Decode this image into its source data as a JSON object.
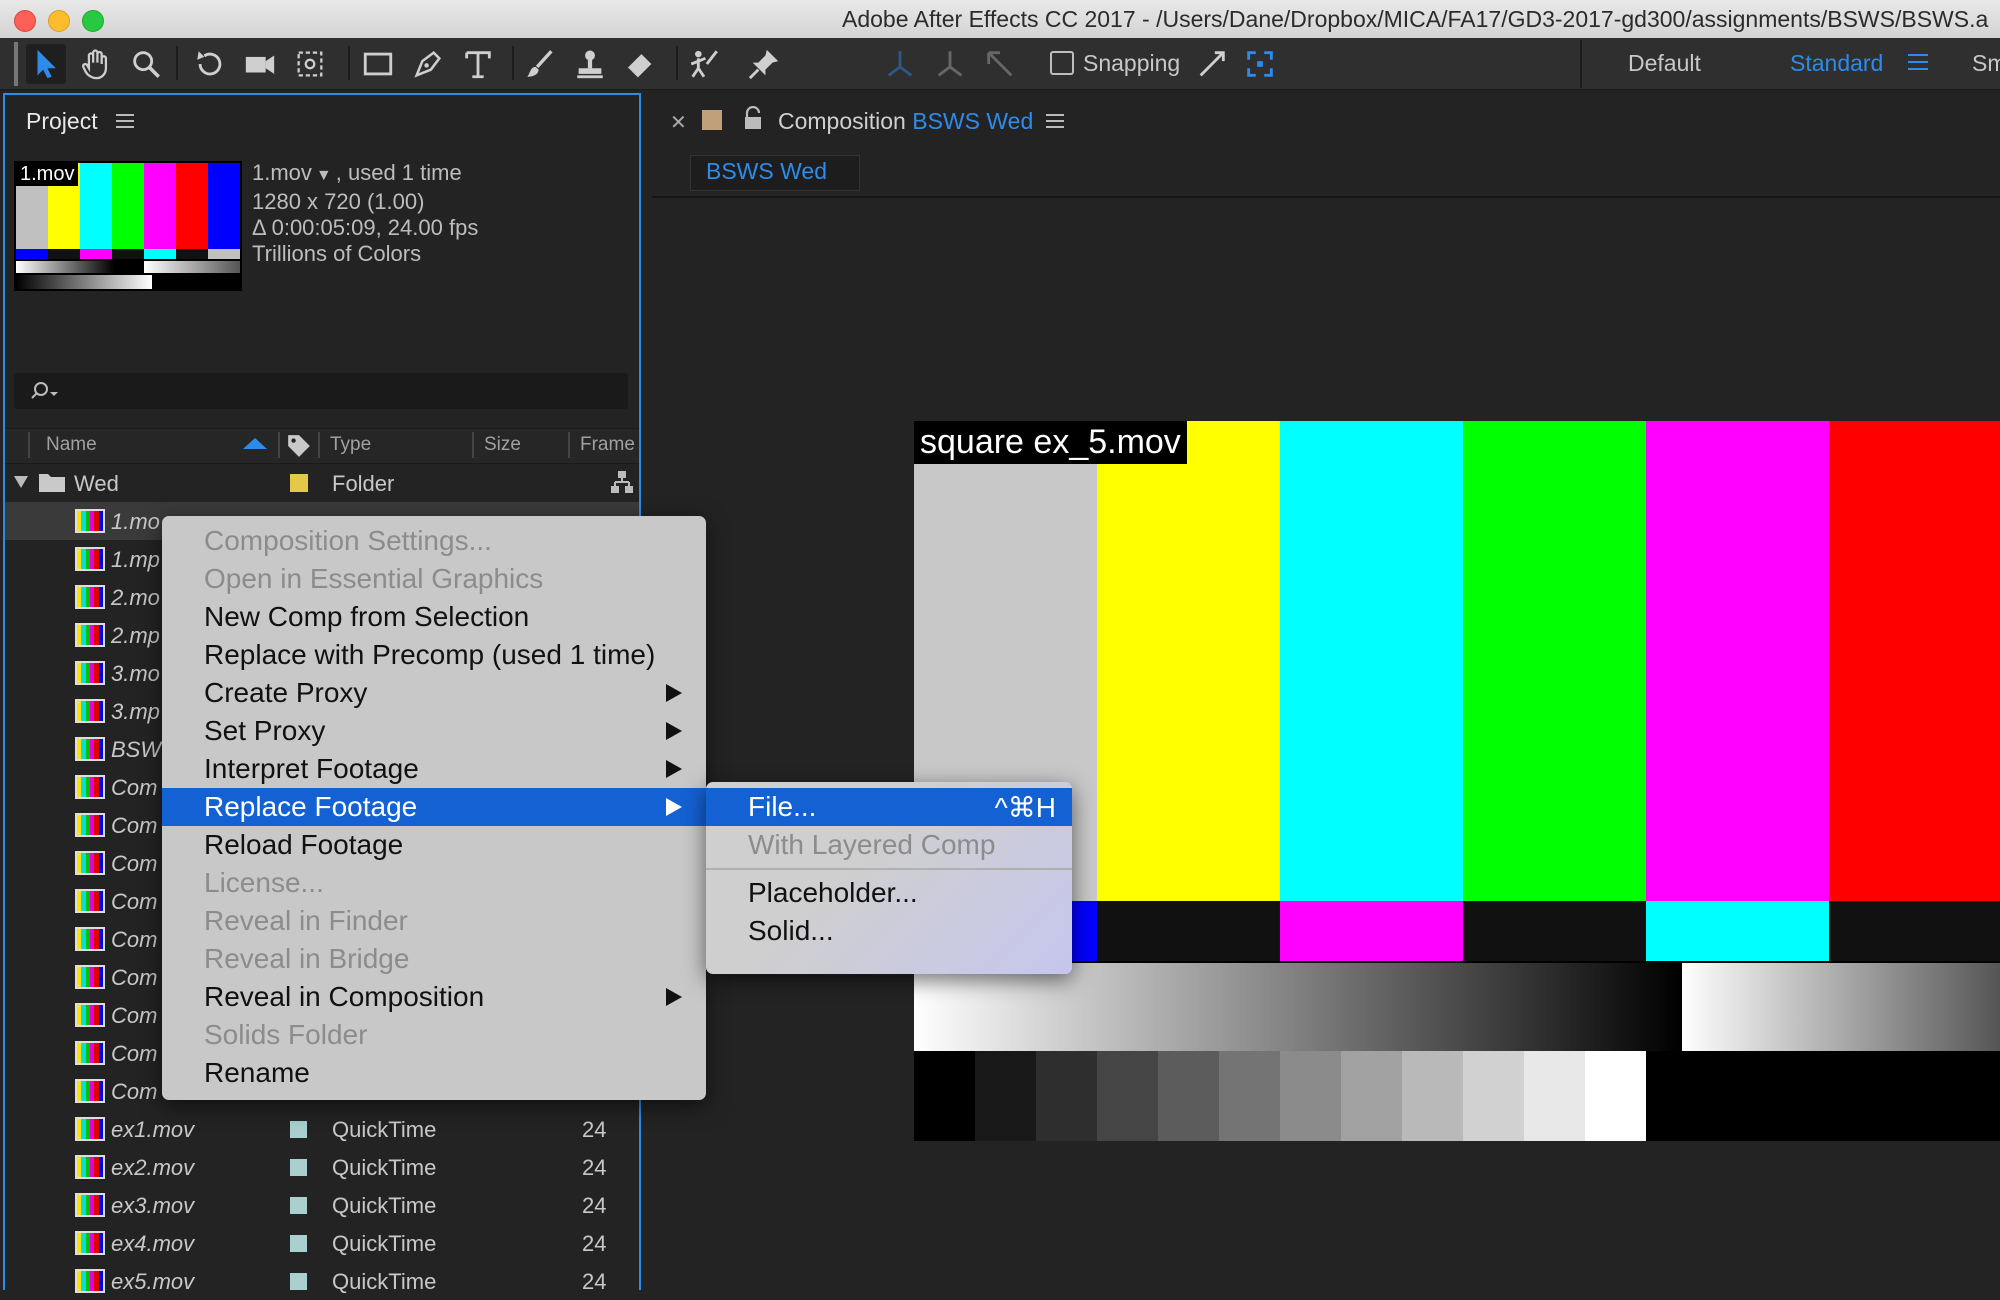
{
  "window": {
    "title": "Adobe After Effects CC 2017 - /Users/Dane/Dropbox/MICA/FA17/GD3-2017-gd300/assignments/BSWS/BSWS.a"
  },
  "toolbar": {
    "snapping_label": "Snapping",
    "workspace_default": "Default",
    "workspace_standard": "Standard",
    "workspace_small": "Sm",
    "accent": "#2d8ceb"
  },
  "project": {
    "title": "Project",
    "thumb_label": "1.mov",
    "info": {
      "name": "1.mov",
      "used": ", used 1 time",
      "dimensions": "1280 x 720 (1.00)",
      "duration": "Δ 0:00:05:09, 24.00 fps",
      "colors": "Trillions of Colors"
    },
    "search_icon": "search-icon",
    "columns": {
      "name": "Name",
      "type": "Type",
      "size": "Size",
      "frame": "Frame"
    },
    "folder": {
      "name": "Wed",
      "type": "Folder",
      "label_color": "#e4c84a"
    },
    "items": [
      {
        "name": "1.mo",
        "type": "",
        "frame": ""
      },
      {
        "name": "1.mp",
        "type": "",
        "frame": ""
      },
      {
        "name": "2.mo",
        "type": "",
        "frame": ""
      },
      {
        "name": "2.mp",
        "type": "",
        "frame": ""
      },
      {
        "name": "3.mo",
        "type": "",
        "frame": ""
      },
      {
        "name": "3.mp",
        "type": "",
        "frame": ""
      },
      {
        "name": "BSWS",
        "type": "",
        "frame": ""
      },
      {
        "name": "Com",
        "type": "",
        "frame": ""
      },
      {
        "name": "Com",
        "type": "",
        "frame": ""
      },
      {
        "name": "Com",
        "type": "",
        "frame": ""
      },
      {
        "name": "Com",
        "type": "",
        "frame": ""
      },
      {
        "name": "Com",
        "type": "",
        "frame": ""
      },
      {
        "name": "Com",
        "type": "",
        "frame": ""
      },
      {
        "name": "Com",
        "type": "",
        "frame": ""
      },
      {
        "name": "Com",
        "type": "",
        "frame": ""
      },
      {
        "name": "Com",
        "type": "",
        "frame": ""
      },
      {
        "name": "ex1.mov",
        "type": "QuickTime",
        "frame": "24"
      },
      {
        "name": "ex2.mov",
        "type": "QuickTime",
        "frame": "24"
      },
      {
        "name": "ex3.mov",
        "type": "QuickTime",
        "frame": "24"
      },
      {
        "name": "ex4.mov",
        "type": "QuickTime",
        "frame": "24"
      },
      {
        "name": "ex5.mov",
        "type": "QuickTime",
        "frame": "24"
      }
    ]
  },
  "composition": {
    "panel_prefix": "Composition",
    "panel_name": "BSWS Wed",
    "tab": "BSWS Wed",
    "layer_label": "square ex_5.mov"
  },
  "context_menu": {
    "items": [
      {
        "label": "Composition Settings...",
        "enabled": false,
        "submenu": false
      },
      {
        "label": "Open in Essential Graphics",
        "enabled": false,
        "submenu": false
      },
      {
        "label": "New Comp from Selection",
        "enabled": true,
        "submenu": false
      },
      {
        "label": "Replace with Precomp (used 1 time)",
        "enabled": true,
        "submenu": false
      },
      {
        "label": "Create Proxy",
        "enabled": true,
        "submenu": true
      },
      {
        "label": "Set Proxy",
        "enabled": true,
        "submenu": true
      },
      {
        "label": "Interpret Footage",
        "enabled": true,
        "submenu": true
      },
      {
        "label": "Replace Footage",
        "enabled": true,
        "submenu": true,
        "highlighted": true
      },
      {
        "label": "Reload Footage",
        "enabled": true,
        "submenu": false
      },
      {
        "label": "License...",
        "enabled": false,
        "submenu": false
      },
      {
        "label": "Reveal in Finder",
        "enabled": false,
        "submenu": false
      },
      {
        "label": "Reveal in Bridge",
        "enabled": false,
        "submenu": false
      },
      {
        "label": "Reveal in Composition",
        "enabled": true,
        "submenu": true
      },
      {
        "label": "Solids Folder",
        "enabled": false,
        "submenu": false
      },
      {
        "label": "Rename",
        "enabled": true,
        "submenu": false
      }
    ]
  },
  "submenu": {
    "items": [
      {
        "label": "File...",
        "shortcut": "^⌘H",
        "enabled": true,
        "highlighted": true
      },
      {
        "label": "With Layered Comp",
        "shortcut": "",
        "enabled": false
      },
      {
        "label": "Placeholder...",
        "shortcut": "",
        "enabled": true
      },
      {
        "label": "Solid...",
        "shortcut": "",
        "enabled": true
      }
    ]
  }
}
